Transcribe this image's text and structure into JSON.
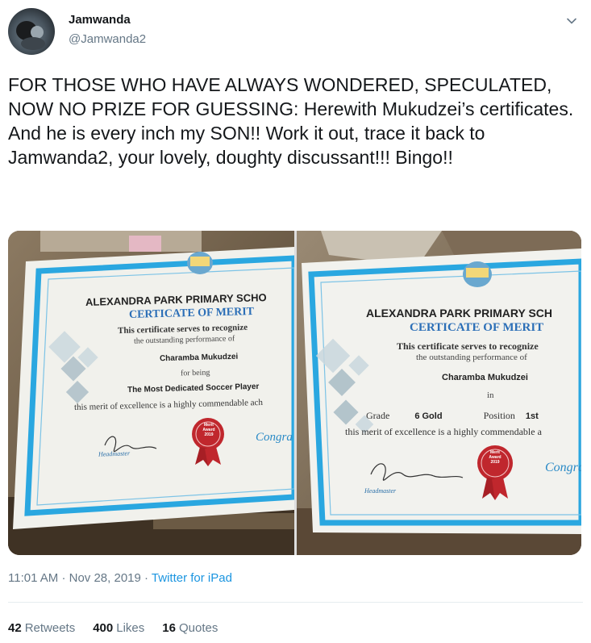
{
  "author": {
    "display_name": "Jamwanda",
    "handle": "@Jamwanda2"
  },
  "tweet": {
    "text": "FOR THOSE WHO HAVE ALWAYS WONDERED, SPECULATED, NOW NO PRIZE FOR GUESSING: Herewith Mukudzei’s certificates. And he is every inch my SON!! Work it out, trace it back to Jamwanda2, your lovely, doughty discussant!!! Bingo!!"
  },
  "photos": [
    {
      "school": "ALEXANDRA PARK PRIMARY SCHO",
      "title": "CERTICATE OF MERIT",
      "serves": "This certificate serves to recognize",
      "performance": "the outstanding performance of",
      "name": "Charamba Mukudzei",
      "for_label": "for being",
      "achievement": "The Most Dedicated Soccer Player",
      "footer": "this merit of excellence is a highly commendable ach",
      "seal": [
        "Merit",
        "Award",
        "2019"
      ],
      "sign_label": "Headmaster",
      "congrats": "Congratul"
    },
    {
      "school": "ALEXANDRA PARK PRIMARY SCH",
      "title": "CERTICATE OF MERIT",
      "serves": "This certificate serves to recognize",
      "performance": "the outstanding performance of",
      "name": "Charamba Mukudzei",
      "in_label": "in",
      "grade_label": "Grade",
      "grade_value": "6 Gold",
      "position_label": "Position",
      "position_value": "1st",
      "footer": "this merit of excellence is a highly commendable a",
      "seal": [
        "Merit",
        "Award",
        "2019"
      ],
      "sign_label": "Headmaster",
      "congrats": "Congratul"
    }
  ],
  "meta": {
    "time": "11:01 AM",
    "sep1": "·",
    "date": "Nov 28, 2019",
    "sep2": "·",
    "source": "Twitter for iPad"
  },
  "stats": {
    "retweets_count": "42",
    "retweets_label": "Retweets",
    "likes_count": "400",
    "likes_label": "Likes",
    "quotes_count": "16",
    "quotes_label": "Quotes"
  },
  "colors": {
    "link": "#1b95e0",
    "secondary_text": "#657786",
    "certificate_border": "#2aa7e0",
    "certificate_title": "#2c6fb7",
    "seal": "#c0272d"
  }
}
